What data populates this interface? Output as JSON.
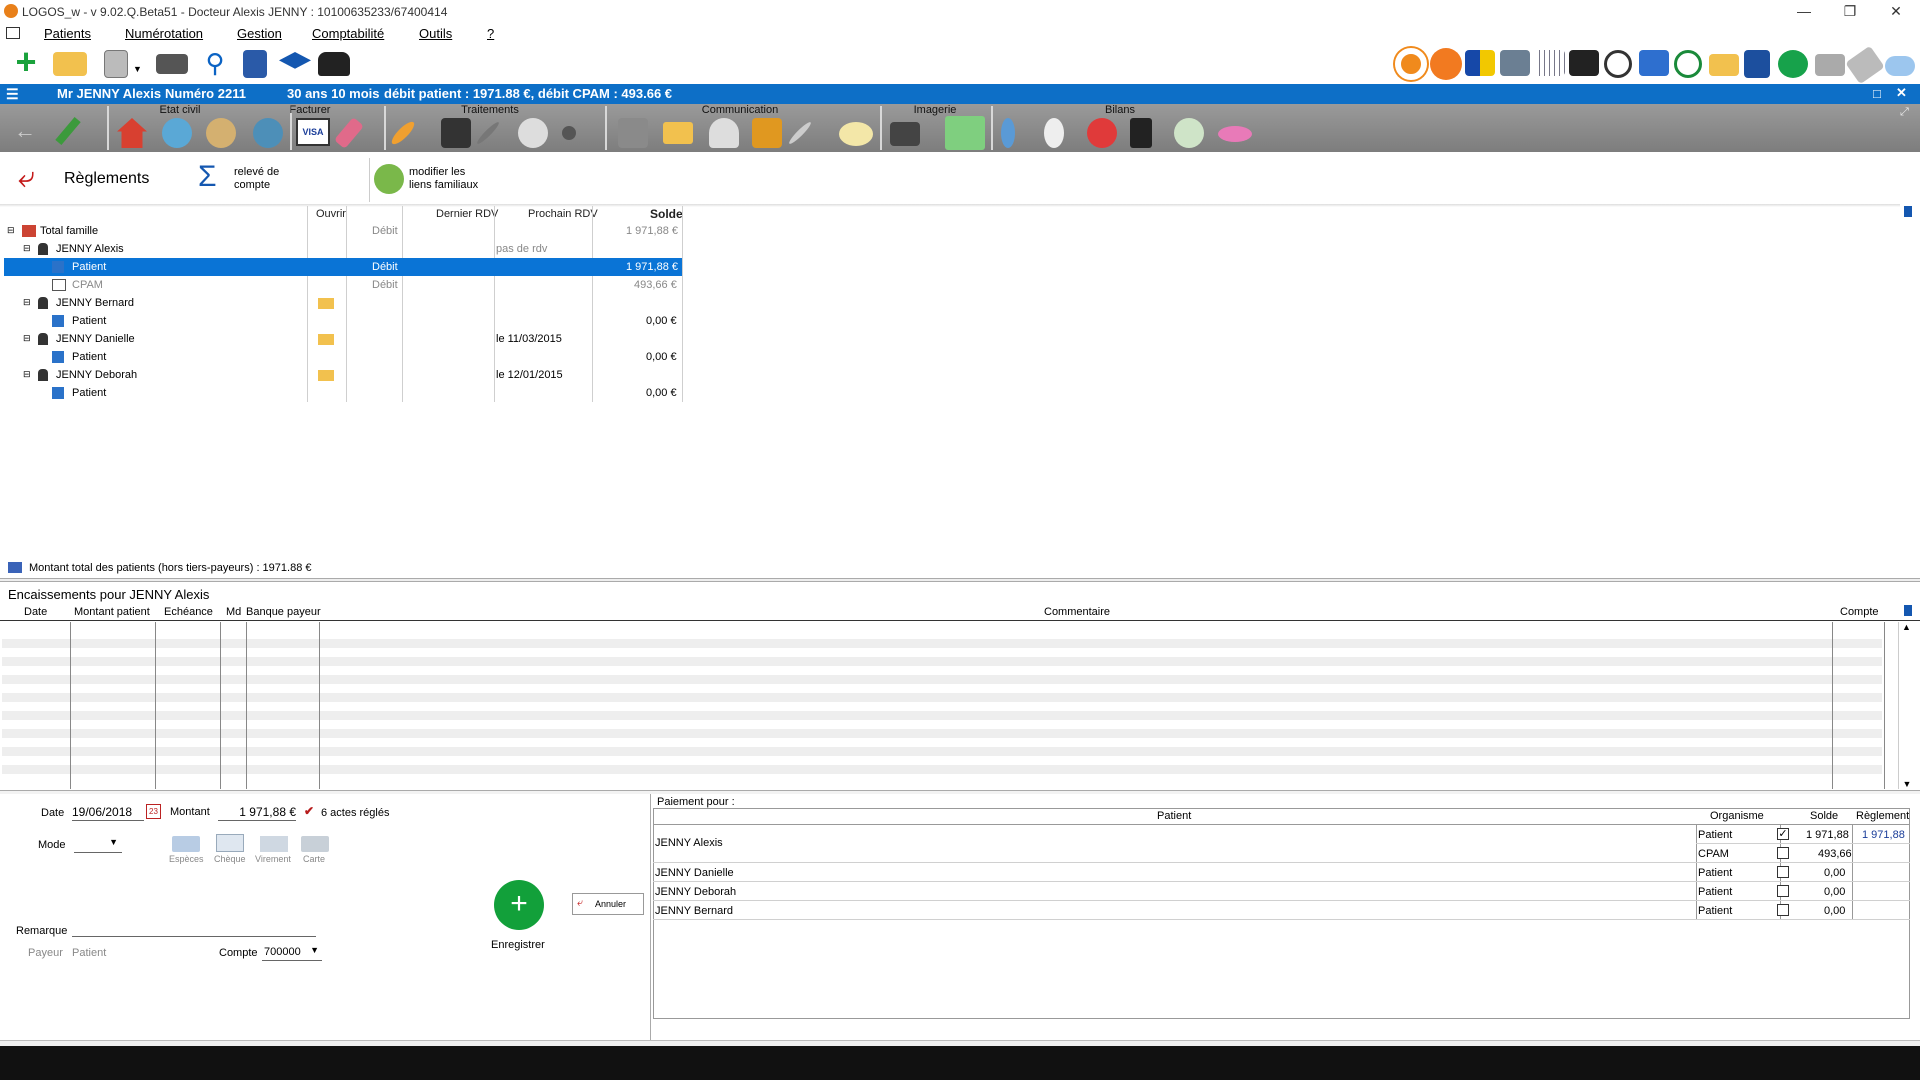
{
  "window": {
    "title": "LOGOS_w - v 9.02.Q.Beta51   -  Docteur Alexis JENNY : 10100635233/67400414"
  },
  "menu": [
    "Patients",
    "Numérotation",
    "Gestion",
    "Comptabilité",
    "Outils",
    "?"
  ],
  "patient_bar": {
    "name": "Mr JENNY Alexis",
    "number": "Numéro 2211",
    "age": "30 ans 10 mois",
    "debits": "débit patient : 1971.88 €, débit CPAM : 493.66 €"
  },
  "module_groups": [
    "Etat civil",
    "Facturer",
    "Traitements",
    "Communication",
    "Imagerie",
    "Bilans"
  ],
  "actions": {
    "back_title": "Règlements",
    "releve": "relevé de\ncompte",
    "releve_1": "relevé de",
    "releve_2": "compte",
    "modifier_1": "modifier les",
    "modifier_2": "liens familiaux"
  },
  "family_table": {
    "headers": {
      "ouvrir": "Ouvrir",
      "dernier": "Dernier RDV",
      "prochain": "Prochain RDV",
      "solde": "Solde"
    },
    "rows": [
      {
        "label": "Total famille",
        "type": "Débit",
        "prochain": "",
        "solde": "1 971,88 €"
      },
      {
        "label": "JENNY Alexis",
        "type": "",
        "prochain": "pas de rdv",
        "solde": ""
      },
      {
        "label": "Patient",
        "type": "Débit",
        "prochain": "",
        "solde": "1 971,88 €"
      },
      {
        "label": "CPAM",
        "type": "Débit",
        "prochain": "",
        "solde": "493,66 €"
      },
      {
        "label": "JENNY Bernard",
        "type": "",
        "prochain": "",
        "solde": ""
      },
      {
        "label": "Patient",
        "type": "",
        "prochain": "",
        "solde": "0,00 €"
      },
      {
        "label": "JENNY Danielle",
        "type": "",
        "prochain": "le 11/03/2015",
        "solde": ""
      },
      {
        "label": "Patient",
        "type": "",
        "prochain": "",
        "solde": "0,00 €"
      },
      {
        "label": "JENNY Deborah",
        "type": "",
        "prochain": "le 12/01/2015",
        "solde": ""
      },
      {
        "label": "Patient",
        "type": "",
        "prochain": "",
        "solde": "0,00 €"
      }
    ],
    "total_note": "Montant total des patients (hors tiers-payeurs) : 1971.88 €"
  },
  "encaissements": {
    "title": "Encaissements pour JENNY Alexis",
    "headers": {
      "date": "Date",
      "montant": "Montant patient",
      "echeance": "Echéance",
      "md": "Md",
      "banque": "Banque payeur",
      "commentaire": "Commentaire",
      "compte": "Compte"
    }
  },
  "form": {
    "date_label": "Date",
    "date_value": "19/06/2018",
    "montant_label": "Montant",
    "montant_value": "1 971,88 €",
    "actes": "6 actes réglés",
    "mode_label": "Mode",
    "modes": [
      "Espèces",
      "Chèque",
      "Virement",
      "Carte"
    ],
    "remarque_label": "Remarque",
    "payeur_label": "Payeur",
    "payeur_value": "Patient",
    "compte_label": "Compte",
    "compte_value": "700000",
    "enregistrer": "Enregistrer",
    "annuler": "Annuler"
  },
  "paiement": {
    "title": "Paiement pour :",
    "headers": {
      "patient": "Patient",
      "organisme": "Organisme",
      "solde": "Solde",
      "reglement": "Règlement"
    },
    "rows": [
      {
        "patient": "JENNY Alexis",
        "organisme": "Patient",
        "checked": "✓",
        "solde": "1 971,88",
        "reglement": "1 971,88"
      },
      {
        "patient": "",
        "organisme": "CPAM",
        "checked": "",
        "solde": "493,66",
        "reglement": ""
      },
      {
        "patient": "JENNY Danielle",
        "organisme": "Patient",
        "checked": "",
        "solde": "0,00",
        "reglement": ""
      },
      {
        "patient": "JENNY Deborah",
        "organisme": "Patient",
        "checked": "",
        "solde": "0,00",
        "reglement": ""
      },
      {
        "patient": "JENNY Bernard",
        "organisme": "Patient",
        "checked": "",
        "solde": "0,00",
        "reglement": ""
      }
    ]
  },
  "colors": {
    "accent": "#0d6fc7",
    "selection": "#0a74d6",
    "save": "#12a03a",
    "toolbar_grey": "#8a8a8a"
  }
}
